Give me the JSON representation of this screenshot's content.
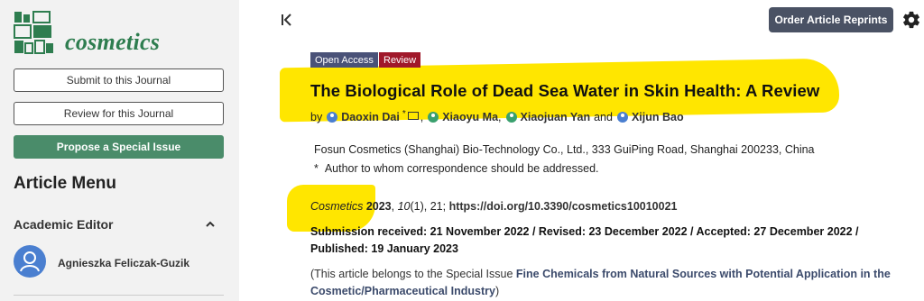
{
  "sidebar": {
    "journal_name": "cosmetics",
    "buttons": {
      "submit": "Submit to this Journal",
      "review": "Review for this Journal",
      "propose": "Propose a Special Issue"
    },
    "article_menu": "Article Menu",
    "academic_editor": {
      "title": "Academic Editor",
      "name": "Agnieszka Feliczak-Guzik"
    }
  },
  "header": {
    "reprints_button": "Order Article Reprints"
  },
  "article": {
    "badges": [
      "Open Access",
      "Review"
    ],
    "title": "The Biological Role of Dead Sea Water in Skin Health: A Review",
    "by": "by",
    "authors": [
      {
        "name": "Daoxin Dai",
        "marker": "*",
        "icon_color": "#4a7fd0"
      },
      {
        "name": "Xiaoyu Ma",
        "icon_color": "#3aa06e"
      },
      {
        "name": "Xiaojuan Yan",
        "icon_color": "#3aa06e"
      },
      {
        "name": "Xijun Bao",
        "icon_color": "#4a7fd0"
      }
    ],
    "author_sep": ",",
    "author_and": "and",
    "affiliation": "Fosun Cosmetics (Shanghai) Bio-Technology Co., Ltd., 333 GuiPing Road, Shanghai 200233, China",
    "corr_marker": "*",
    "correspondence": "Author to whom correspondence should be addressed.",
    "citation": {
      "journal": "Cosmetics",
      "year": "2023",
      "volume": "10",
      "issue": "(1)",
      "article_no": ", 21; ",
      "doi": "https://doi.org/10.3390/cosmetics10010021"
    },
    "dates": "Submission received: 21 November 2022 / Revised: 23 December 2022 / Accepted: 27 December 2022 / Published: 19 January 2023",
    "special_issue": {
      "prefix": "(This article belongs to the Special Issue ",
      "link": "Fine Chemicals from Natural Sources with Potential Application in the Cosmetic/Pharmaceutical Industry",
      "suffix": ")"
    }
  },
  "colors": {
    "highlight": "#ffe600",
    "brand_green": "#2e7d4f",
    "review_badge": "#a0182a",
    "open_access_badge": "#4a5278"
  }
}
